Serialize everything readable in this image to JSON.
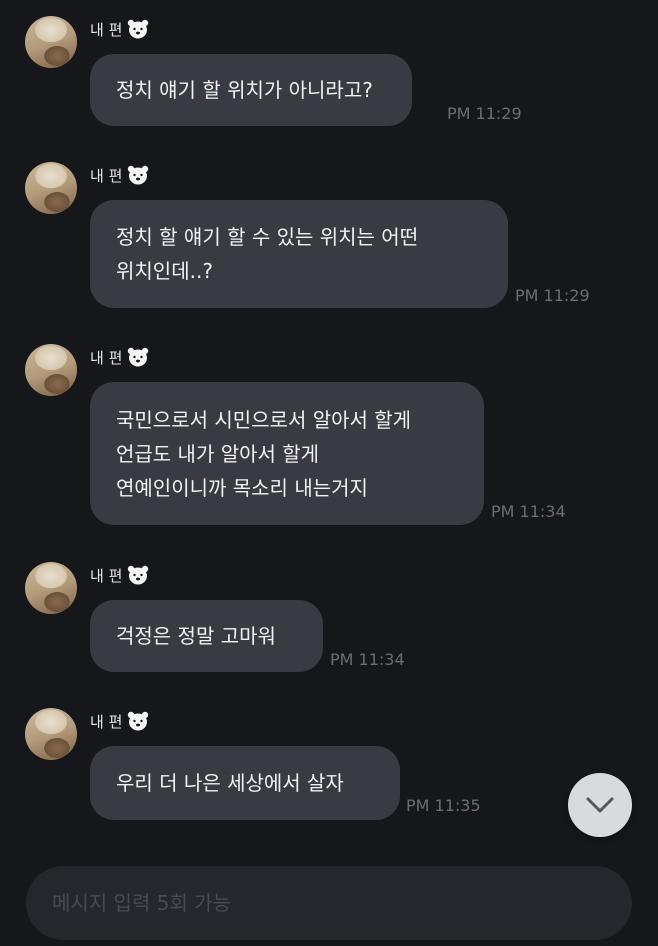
{
  "messages": [
    {
      "sender": "내 편",
      "lines": [
        "정치 얘기 할 위치가 아니라고?"
      ],
      "time": "PM 11:29"
    },
    {
      "sender": "내 편",
      "lines": [
        "정치 할 얘기 할 수 있는 위치는 어떤",
        "위치인데..?"
      ],
      "time": "PM 11:29"
    },
    {
      "sender": "내 편",
      "lines": [
        "국민으로서 시민으로서 알아서 할게",
        "언급도 내가 알아서 할게",
        "연예인이니까 목소리 내는거지"
      ],
      "time": "PM 11:34"
    },
    {
      "sender": "내 편",
      "lines": [
        "걱정은 정말 고마워"
      ],
      "time": "PM 11:34"
    },
    {
      "sender": "내 편",
      "lines": [
        "우리 더 나은 세상에서 살자"
      ],
      "time": "PM 11:35"
    }
  ],
  "input": {
    "placeholder": "메시지 입력 5회 가능",
    "value": ""
  },
  "icons": {
    "sender_badge": "bear-icon",
    "scroll": "chevron-down-icon",
    "avatar": "profile-avatar"
  },
  "colors": {
    "background": "#16171b",
    "bubble": "#3a3b42",
    "time": "#6c6d73",
    "input_bar": "#26272c"
  }
}
